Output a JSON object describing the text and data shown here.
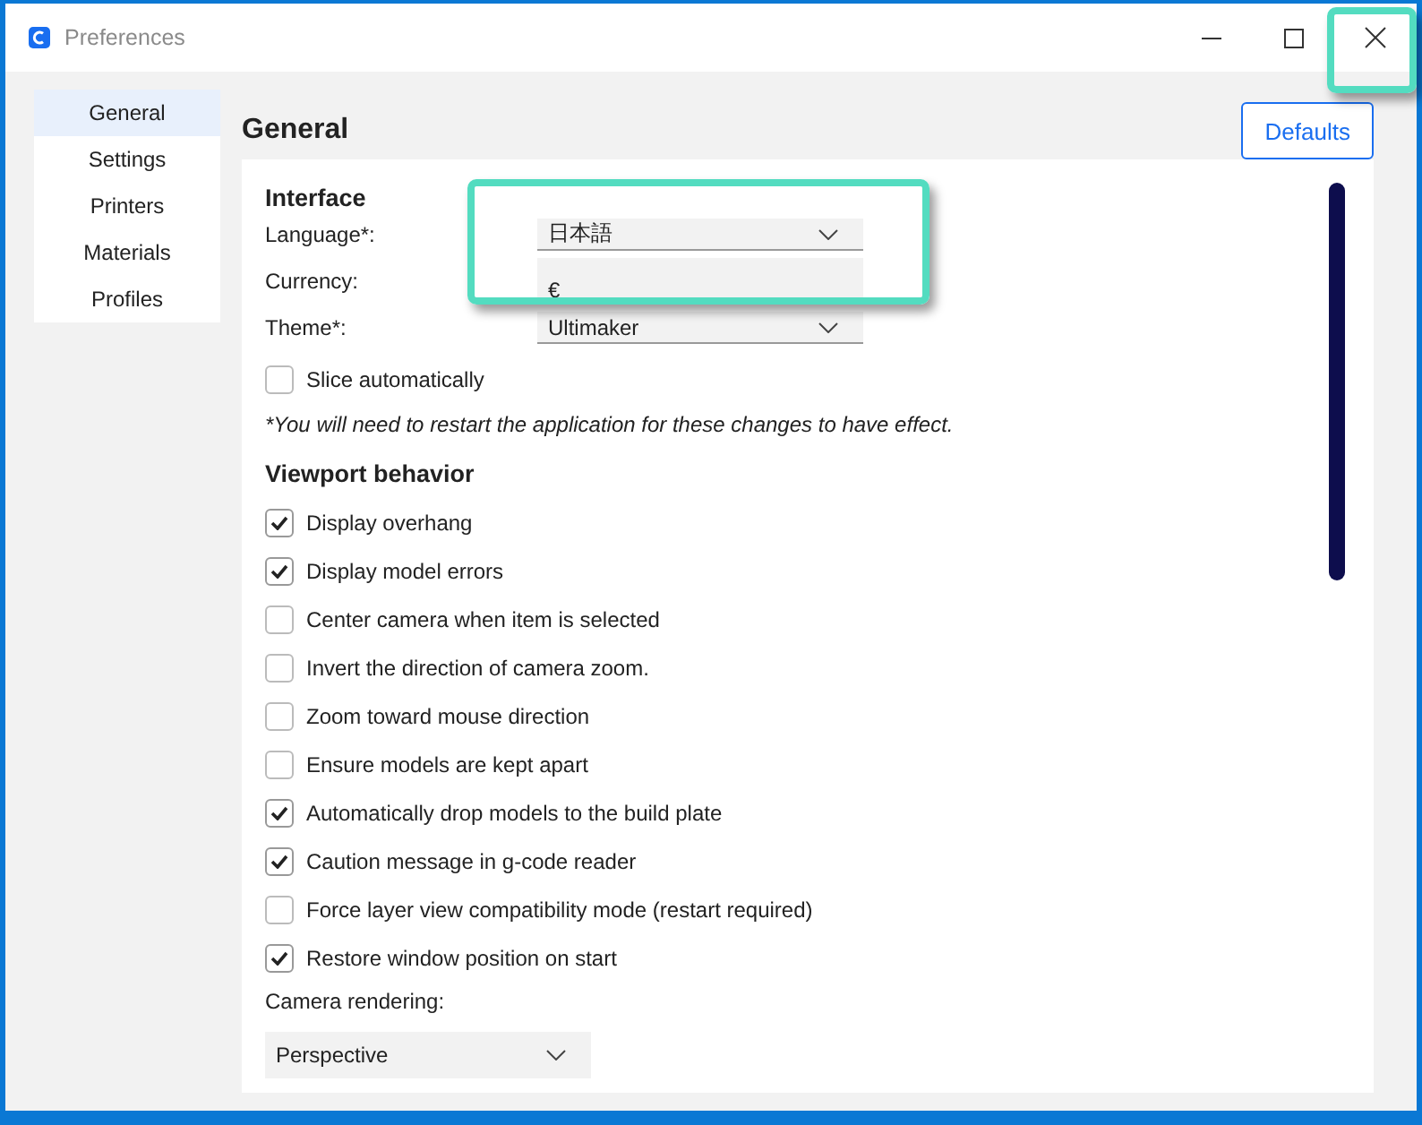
{
  "window": {
    "title": "Preferences"
  },
  "sidebar": {
    "items": [
      {
        "label": "General",
        "selected": true
      },
      {
        "label": "Settings",
        "selected": false
      },
      {
        "label": "Printers",
        "selected": false
      },
      {
        "label": "Materials",
        "selected": false
      },
      {
        "label": "Profiles",
        "selected": false
      }
    ]
  },
  "page": {
    "title": "General",
    "defaults_button": "Defaults"
  },
  "interface": {
    "heading": "Interface",
    "fields": [
      {
        "label": "Language*:",
        "value": "日本語",
        "kind": "dropdown"
      },
      {
        "label": "Currency:",
        "value": "€",
        "kind": "text"
      },
      {
        "label": "Theme*:",
        "value": "Ultimaker",
        "kind": "dropdown"
      }
    ],
    "slice_automatically": {
      "label": "Slice automatically",
      "checked": false
    },
    "note": "*You will need to restart the application for these changes to have effect."
  },
  "viewport": {
    "heading": "Viewport behavior",
    "options": [
      {
        "label": "Display overhang",
        "checked": true
      },
      {
        "label": "Display model errors",
        "checked": true
      },
      {
        "label": "Center camera when item is selected",
        "checked": false
      },
      {
        "label": "Invert the direction of camera zoom.",
        "checked": false
      },
      {
        "label": "Zoom toward mouse direction",
        "checked": false
      },
      {
        "label": "Ensure models are kept apart",
        "checked": false
      },
      {
        "label": "Automatically drop models to the build plate",
        "checked": true
      },
      {
        "label": "Caution message in g-code reader",
        "checked": true
      },
      {
        "label": "Force layer view compatibility mode (restart required)",
        "checked": false
      },
      {
        "label": "Restore window position on start",
        "checked": true
      }
    ],
    "camera_rendering": {
      "label": "Camera rendering:",
      "value": "Perspective"
    }
  }
}
